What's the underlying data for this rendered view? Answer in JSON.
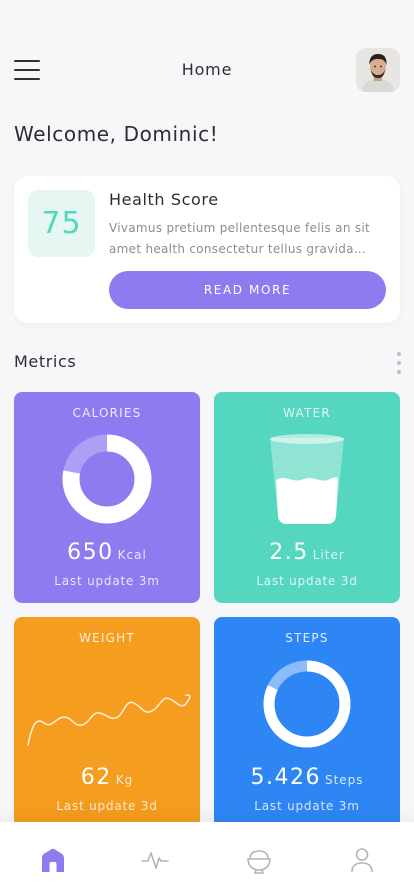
{
  "header": {
    "title": "Home",
    "menu_icon": "hamburger-menu-icon",
    "avatar": "user-avatar"
  },
  "welcome": "Welcome, Dominic!",
  "health_score": {
    "score": "75",
    "title": "Health Score",
    "description": "Vivamus pretium pellentesque felis an sit amet health consectetur tellus gravida…",
    "button_label": "READ MORE"
  },
  "metrics": {
    "title": "Metrics",
    "tiles": [
      {
        "label": "CALORIES",
        "value": "650",
        "unit": "Kcal",
        "update": "Last update 3m",
        "color": "#8c7cf0",
        "graphic": "donut-chart",
        "progress": 0.78
      },
      {
        "label": "WATER",
        "value": "2.5",
        "unit": "Liter",
        "update": "Last update 3d",
        "color": "#55d6be",
        "graphic": "water-glass-icon"
      },
      {
        "label": "WEIGHT",
        "value": "62",
        "unit": "Kg",
        "update": "Last update 3d",
        "color": "#f49d1e",
        "graphic": "weight-trend-line"
      },
      {
        "label": "STEPS",
        "value": "5.426",
        "unit": "Steps",
        "update": "Last update 3m",
        "color": "#2e86f5",
        "graphic": "donut-chart",
        "progress": 0.82
      }
    ]
  },
  "colors": {
    "accent": "#8c7cf0",
    "teal": "#55d6be",
    "orange": "#f49d1e",
    "blue": "#2e86f5"
  },
  "bottom_nav": [
    {
      "name": "home",
      "icon": "home-icon",
      "active": true
    },
    {
      "name": "activity",
      "icon": "activity-pulse-icon",
      "active": false
    },
    {
      "name": "food",
      "icon": "food-bowl-icon",
      "active": false
    },
    {
      "name": "profile",
      "icon": "person-icon",
      "active": false
    }
  ]
}
